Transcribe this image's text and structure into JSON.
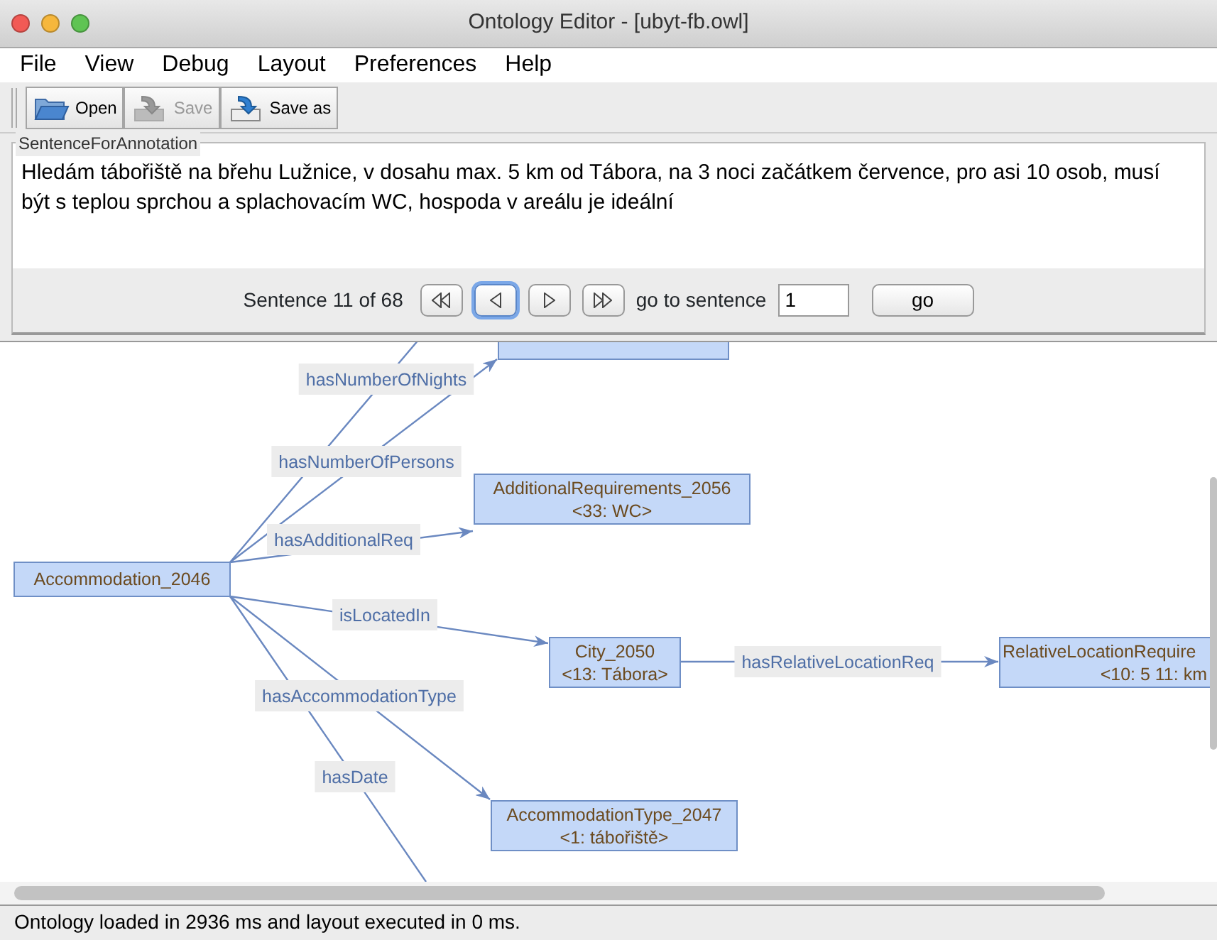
{
  "window": {
    "title": "Ontology Editor - [ubyt-fb.owl]"
  },
  "menu": [
    "File",
    "View",
    "Debug",
    "Layout",
    "Preferences",
    "Help"
  ],
  "toolbar": [
    {
      "label": "Open",
      "disabled": false
    },
    {
      "label": "Save",
      "disabled": true
    },
    {
      "label": "Save as",
      "disabled": false
    }
  ],
  "sentence_panel": {
    "title": "SentenceForAnnotation",
    "text": "Hledám tábořiště na břehu Lužnice, v dosahu max. 5 km od Tábora, na 3 noci začátkem července, pro asi 10 osob, musí být s teplou sprchou a splachovacím WC, hospoda v areálu je ideální",
    "counter": "Sentence 11 of 68",
    "nav_buttons": [
      {
        "kind": "first",
        "focused": false
      },
      {
        "kind": "prev",
        "focused": true
      },
      {
        "kind": "next",
        "focused": false
      },
      {
        "kind": "last",
        "focused": false
      }
    ],
    "goto_label": "go to sentence",
    "goto_value": "1",
    "go_button": "go"
  },
  "graph": {
    "nodes": [
      {
        "label": "Accommodation_2046"
      },
      {
        "label": "AdditionalRequirements_2056",
        "detail": "<33: WC>"
      },
      {
        "label": "City_2050",
        "detail": "<13: Tábora>"
      },
      {
        "label": "RelativeLocationRequire",
        "detail": "<10: 5 11: km"
      },
      {
        "label": "AccommodationType_2047",
        "detail": "<1: tábořiště>"
      }
    ],
    "edges": [
      {
        "label": "hasNumberOfNights"
      },
      {
        "label": "hasNumberOfPersons"
      },
      {
        "label": "hasAdditionalReq"
      },
      {
        "label": "isLocatedIn"
      },
      {
        "label": "hasAccommodationType"
      },
      {
        "label": "hasDate"
      },
      {
        "label": "hasRelativeLocationReq"
      }
    ]
  },
  "status_bar": "Ontology loaded in 2936 ms and layout executed in 0 ms."
}
